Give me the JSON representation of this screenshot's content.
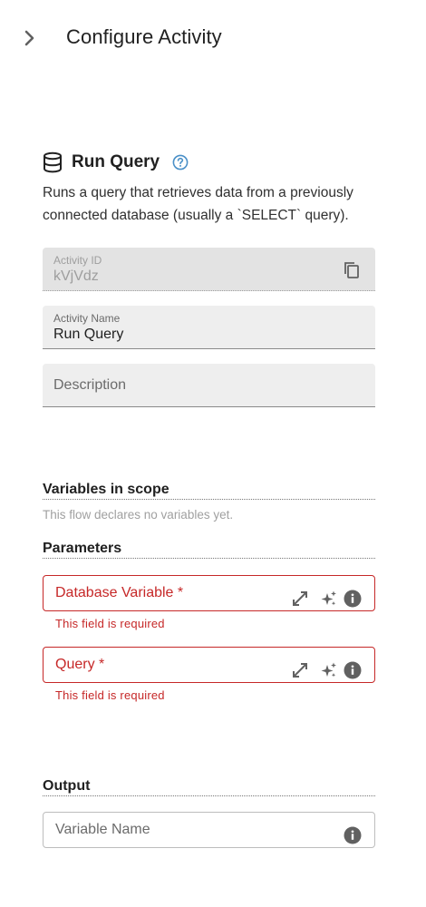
{
  "header": {
    "back_icon": "chevron-right-icon",
    "title": "Configure Activity"
  },
  "activity": {
    "icon": "database-icon",
    "name": "Run Query",
    "help_icon": "help-circle-icon",
    "description": "Runs a query that retrieves data from a previously connected database (usually a `SELECT` query)."
  },
  "fields": {
    "activity_id": {
      "label": "Activity ID",
      "value": "kVjVdz",
      "copy_icon": "copy-icon"
    },
    "activity_name": {
      "label": "Activity Name",
      "value": "Run Query"
    },
    "description": {
      "placeholder": "Description"
    }
  },
  "variables": {
    "title": "Variables in scope",
    "note": "This flow declares no variables yet."
  },
  "parameters": {
    "title": "Parameters",
    "items": [
      {
        "label": "Database Variable *",
        "error": "This field is required"
      },
      {
        "label": "Query *",
        "error": "This field is required"
      }
    ]
  },
  "output": {
    "title": "Output",
    "variable_name_label": "Variable Name"
  },
  "colors": {
    "error": "#c62828",
    "accent_help": "#4a90c8",
    "field_bg": "#eeeeee"
  }
}
